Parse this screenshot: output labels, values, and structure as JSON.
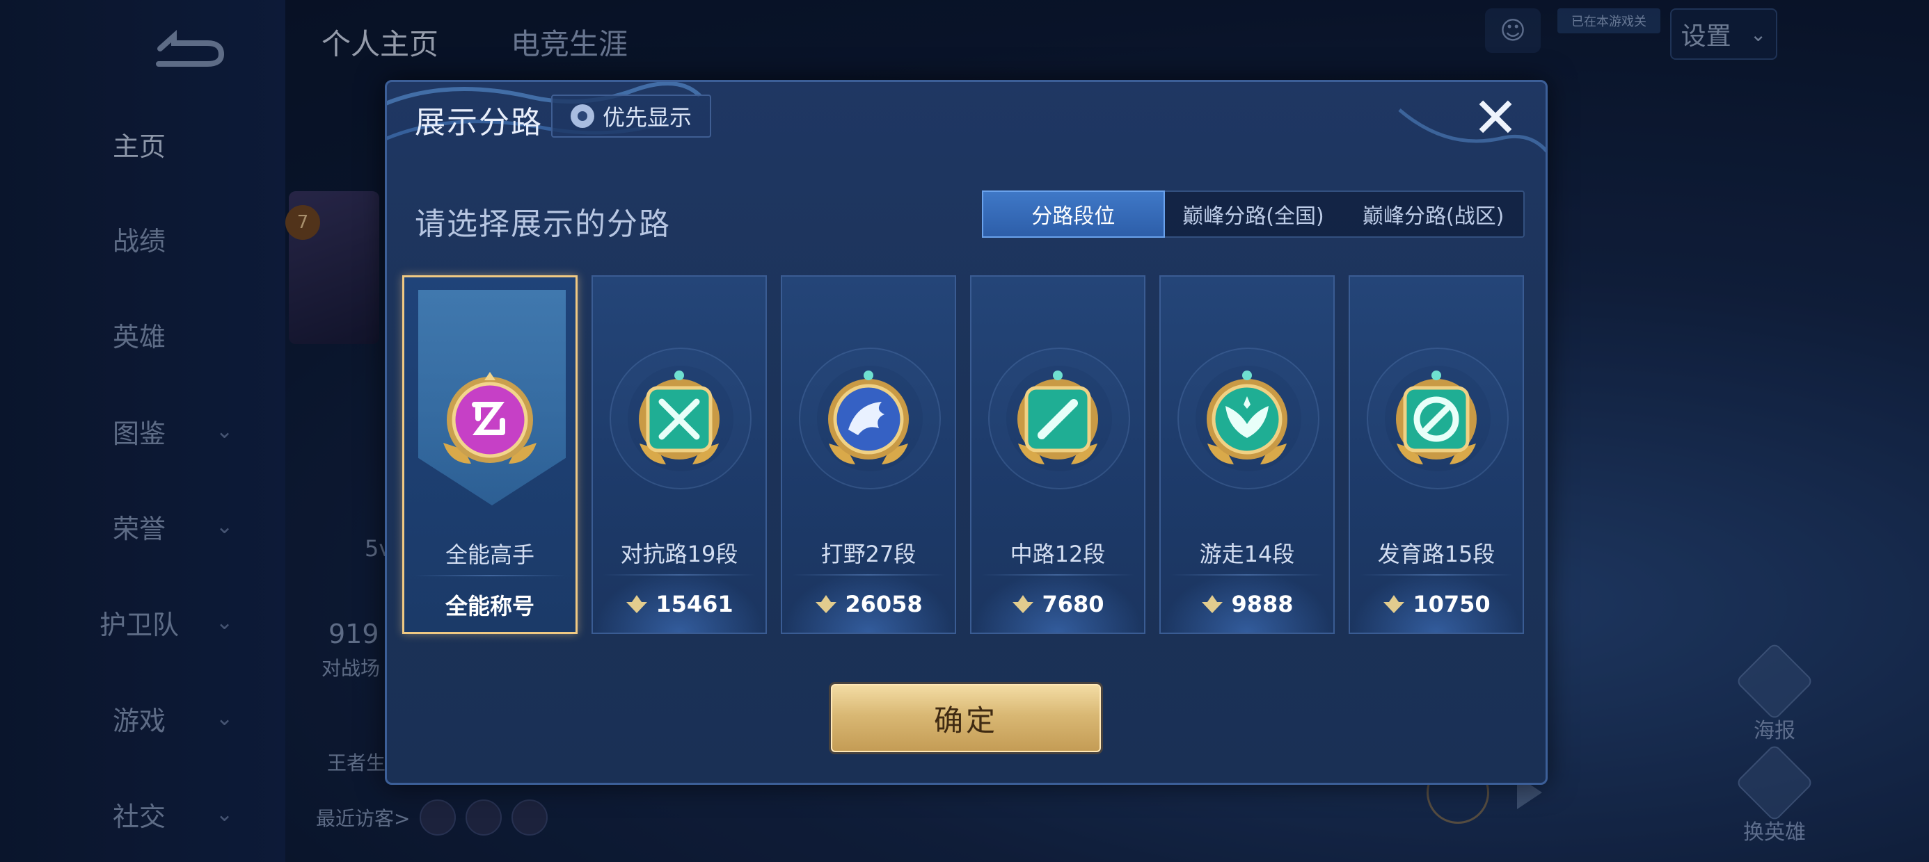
{
  "background": {
    "tabs": [
      "个人主页",
      "电竞生涯"
    ],
    "sidebar": [
      {
        "label": "主页",
        "chevron": false,
        "active": true
      },
      {
        "label": "战绩",
        "chevron": false
      },
      {
        "label": "英雄",
        "chevron": false
      },
      {
        "label": "图鉴",
        "chevron": true
      },
      {
        "label": "荣誉",
        "chevron": true
      },
      {
        "label": "护卫队",
        "chevron": true
      },
      {
        "label": "游戏",
        "chevron": true
      },
      {
        "label": "社交",
        "chevron": true
      }
    ],
    "settings_label": "设置",
    "top_badge": "已在本游戏关",
    "profile_level": "7",
    "partial_5v": "5v",
    "partial_919": "919",
    "partial_battle": "对战场",
    "partial_king": "王者生",
    "recent_visitors": "最近访客>",
    "right_tools": [
      "海报",
      "换英雄"
    ]
  },
  "modal": {
    "title": "展示分路",
    "priority_button": "优先显示",
    "subtitle": "请选择展示的分路",
    "tabs": [
      {
        "label": "分路段位",
        "active": true
      },
      {
        "label": "巅峰分路(全国)",
        "active": false
      },
      {
        "label": "巅峰分路(战区)",
        "active": false
      }
    ],
    "cards": [
      {
        "label": "全能高手",
        "value": "全能称号",
        "icon": "all-round-medal-icon",
        "color": "#c640c6",
        "selected": true
      },
      {
        "label": "对抗路19段",
        "value": "15461",
        "icon": "clash-lane-medal-icon",
        "color": "#2fc7a8",
        "selected": false
      },
      {
        "label": "打野27段",
        "value": "26058",
        "icon": "jungle-dragon-medal-icon",
        "color": "#3f6fd1",
        "selected": false
      },
      {
        "label": "中路12段",
        "value": "7680",
        "icon": "mid-lane-medal-icon",
        "color": "#2fc7a8",
        "selected": false
      },
      {
        "label": "游走14段",
        "value": "9888",
        "icon": "roam-medal-icon",
        "color": "#2fc7a8",
        "selected": false
      },
      {
        "label": "发育路15段",
        "value": "10750",
        "icon": "farm-lane-medal-icon",
        "color": "#2fc7a8",
        "selected": false
      }
    ],
    "confirm": "确定"
  }
}
